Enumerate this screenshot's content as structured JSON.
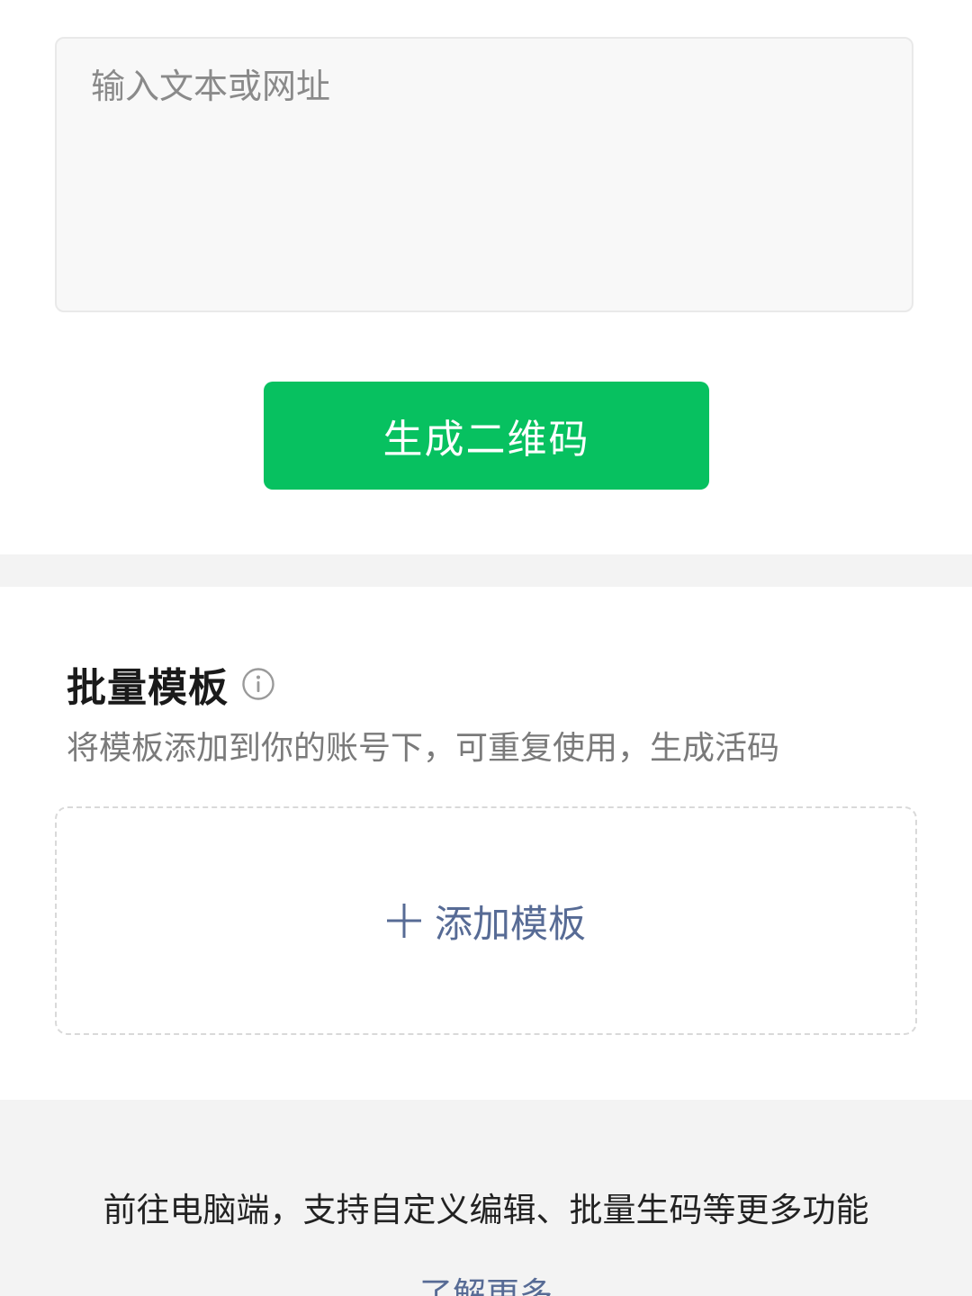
{
  "input": {
    "placeholder": "输入文本或网址",
    "value": ""
  },
  "generate_button": {
    "label": "生成二维码"
  },
  "template_section": {
    "title": "批量模板",
    "info_icon": "info-circle-icon",
    "description": "将模板添加到你的账号下，可重复使用，生成活码",
    "add_icon": "plus-icon",
    "add_label": "添加模板"
  },
  "footer": {
    "note": "前往电脑端，支持自定义编辑、批量生码等更多功能",
    "learn_more": "了解更多"
  },
  "colors": {
    "primary_green": "#07c160",
    "link_blue": "#576b95",
    "background_gray": "#f3f3f3"
  }
}
